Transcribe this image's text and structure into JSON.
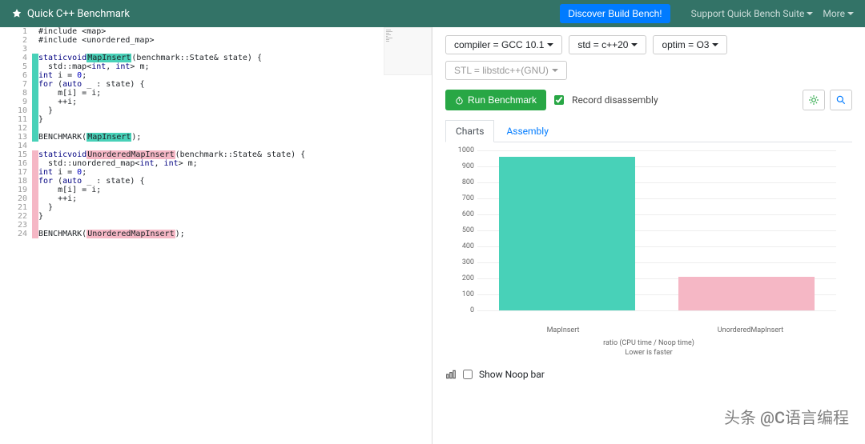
{
  "navbar": {
    "brand": "Quick C++ Benchmark",
    "discover": "Discover Build Bench!",
    "support": "Support Quick Bench Suite",
    "more": "More"
  },
  "options": {
    "compiler": "compiler = GCC 10.1",
    "std": "std = c++20",
    "optim": "optim = O3",
    "stl": "STL = libstdc++(GNU)"
  },
  "run": {
    "label": "Run Benchmark",
    "record": "Record disassembly"
  },
  "tabs": {
    "charts": "Charts",
    "assembly": "Assembly"
  },
  "code_lines": [
    "#include <map>",
    "#include <unordered_map>",
    "",
    "static void MapInsert(benchmark::State& state) {",
    "  std::map<int, int> m;",
    "  int i = 0;",
    "  for (auto _ : state) {",
    "    m[i] = i;",
    "    ++i;",
    "  }",
    "}",
    "",
    "BENCHMARK(MapInsert);",
    "",
    "static void UnorderedMapInsert(benchmark::State& state) {",
    "  std::unordered_map<int, int> m;",
    "  int i = 0;",
    "  for (auto _ : state) {",
    "    m[i] = i;",
    "    ++i;",
    "  }",
    "}",
    "",
    "BENCHMARK(UnorderedMapInsert);"
  ],
  "chart_data": {
    "type": "bar",
    "categories": [
      "MapInsert",
      "UnorderedMapInsert"
    ],
    "values": [
      960,
      210
    ],
    "colors": [
      "#48d1b8",
      "#f5b7c5"
    ],
    "ylim": [
      0,
      1000
    ],
    "yticks": [
      0,
      100,
      200,
      300,
      400,
      500,
      600,
      700,
      800,
      900,
      1000
    ],
    "title": "ratio (CPU time / Noop time)",
    "subtitle": "Lower is faster"
  },
  "noop": {
    "label": "Show Noop bar"
  },
  "watermark": "头条 @C语言编程"
}
